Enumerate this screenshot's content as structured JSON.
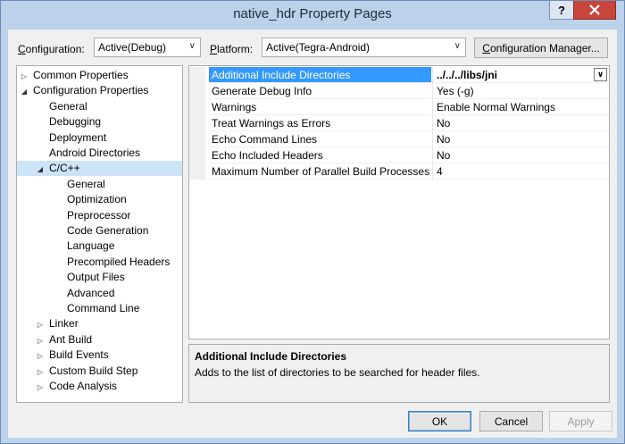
{
  "window": {
    "title": "native_hdr Property Pages",
    "help_glyph": "?",
    "close_glyph": "X"
  },
  "toolbar": {
    "configuration_label_accel": "C",
    "configuration_label_rest": "onfiguration:",
    "configuration_value": "Active(Debug)",
    "platform_label_accel": "P",
    "platform_label_rest": "latform:",
    "platform_value": "Active(Tegra-Android)",
    "manager_accel": "C",
    "manager_rest": "onfiguration Manager..."
  },
  "tree": [
    {
      "label": "Common Properties",
      "level": 0,
      "expander": "collapsed"
    },
    {
      "label": "Configuration Properties",
      "level": 0,
      "expander": "expanded"
    },
    {
      "label": "General",
      "level": 1,
      "expander": "none"
    },
    {
      "label": "Debugging",
      "level": 1,
      "expander": "none"
    },
    {
      "label": "Deployment",
      "level": 1,
      "expander": "none"
    },
    {
      "label": "Android Directories",
      "level": 1,
      "expander": "none"
    },
    {
      "label": "C/C++",
      "level": 1,
      "expander": "expanded",
      "selected": true
    },
    {
      "label": "General",
      "level": 2,
      "expander": "none"
    },
    {
      "label": "Optimization",
      "level": 2,
      "expander": "none"
    },
    {
      "label": "Preprocessor",
      "level": 2,
      "expander": "none"
    },
    {
      "label": "Code Generation",
      "level": 2,
      "expander": "none"
    },
    {
      "label": "Language",
      "level": 2,
      "expander": "none"
    },
    {
      "label": "Precompiled Headers",
      "level": 2,
      "expander": "none"
    },
    {
      "label": "Output Files",
      "level": 2,
      "expander": "none"
    },
    {
      "label": "Advanced",
      "level": 2,
      "expander": "none"
    },
    {
      "label": "Command Line",
      "level": 2,
      "expander": "none"
    },
    {
      "label": "Linker",
      "level": 1,
      "expander": "collapsed"
    },
    {
      "label": "Ant Build",
      "level": 1,
      "expander": "collapsed"
    },
    {
      "label": "Build Events",
      "level": 1,
      "expander": "collapsed"
    },
    {
      "label": "Custom Build Step",
      "level": 1,
      "expander": "collapsed"
    },
    {
      "label": "Code Analysis",
      "level": 1,
      "expander": "collapsed"
    }
  ],
  "properties": [
    {
      "name": "Additional Include Directories",
      "value": "../../../libs/jni",
      "selected": true
    },
    {
      "name": "Generate Debug Info",
      "value": "Yes (-g)"
    },
    {
      "name": "Warnings",
      "value": "Enable Normal Warnings"
    },
    {
      "name": "Treat Warnings as Errors",
      "value": "No"
    },
    {
      "name": "Echo Command Lines",
      "value": "No"
    },
    {
      "name": "Echo Included Headers",
      "value": "No"
    },
    {
      "name": "Maximum Number of Parallel Build Processes",
      "value": "4"
    }
  ],
  "description": {
    "title": "Additional Include Directories",
    "text": "Adds to the list of directories to be searched for header files."
  },
  "buttons": {
    "ok": "OK",
    "cancel": "Cancel",
    "apply": "Apply"
  },
  "colors": {
    "selection": "#3399ff",
    "tree_selection": "#cde4f7",
    "titlebar": "#bcd1ea",
    "close": "#c7453b"
  }
}
